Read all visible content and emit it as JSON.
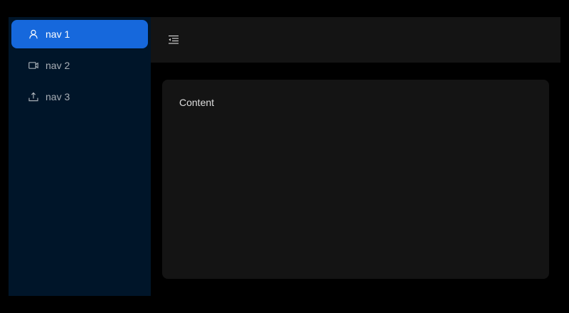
{
  "sidebar": {
    "items": [
      {
        "label": "nav 1",
        "icon": "user-icon",
        "active": true
      },
      {
        "label": "nav 2",
        "icon": "video-camera-icon",
        "active": false
      },
      {
        "label": "nav 3",
        "icon": "upload-icon",
        "active": false
      }
    ]
  },
  "header": {
    "toggle_icon": "menu-fold-icon"
  },
  "main": {
    "content_text": "Content"
  },
  "colors": {
    "page_background": "#000000",
    "sider_background": "#001529",
    "header_background": "#141414",
    "content_background": "#141414",
    "active_item": "#1668dc"
  }
}
